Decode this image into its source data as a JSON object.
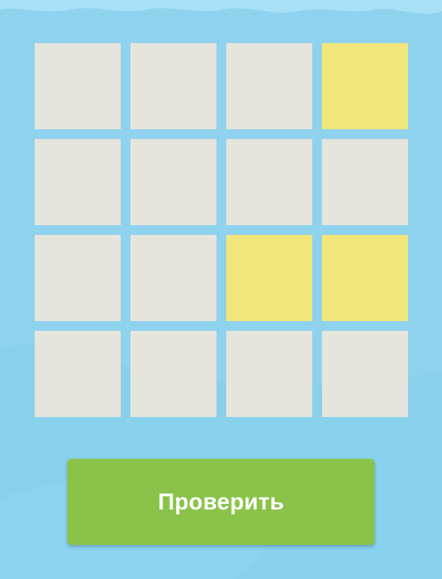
{
  "board": {
    "rows": 4,
    "cols": 4,
    "cells": [
      [
        false,
        false,
        false,
        true
      ],
      [
        false,
        false,
        false,
        false
      ],
      [
        false,
        false,
        true,
        true
      ],
      [
        false,
        false,
        false,
        false
      ]
    ]
  },
  "colors": {
    "background": "#8ed2ee",
    "tile_empty": "#e5e4dd",
    "tile_lit": "#f0e67b",
    "button": "#8bc34a"
  },
  "check_button": {
    "label": "Проверить"
  }
}
